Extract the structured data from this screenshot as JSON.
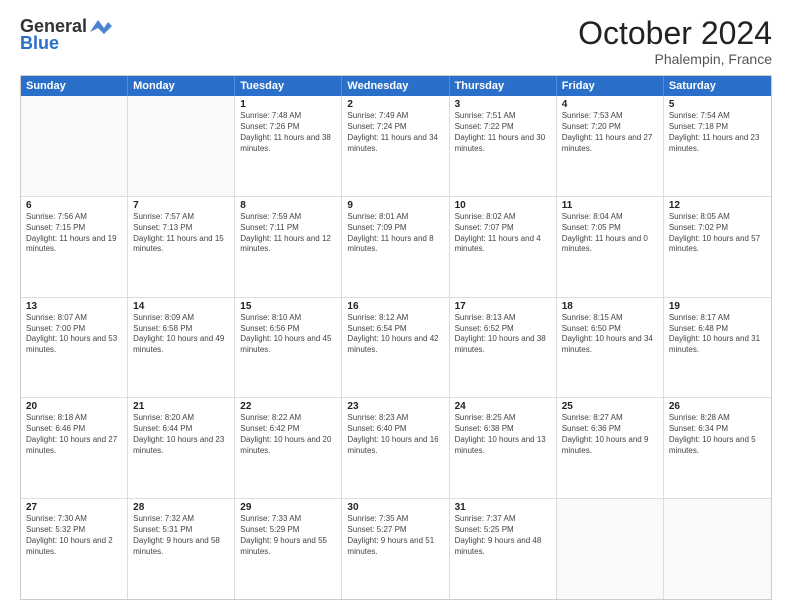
{
  "header": {
    "logo_line1": "General",
    "logo_line2": "Blue",
    "month": "October 2024",
    "location": "Phalempin, France"
  },
  "weekdays": [
    "Sunday",
    "Monday",
    "Tuesday",
    "Wednesday",
    "Thursday",
    "Friday",
    "Saturday"
  ],
  "rows": [
    [
      {
        "day": "",
        "info": ""
      },
      {
        "day": "",
        "info": ""
      },
      {
        "day": "1",
        "info": "Sunrise: 7:48 AM\nSunset: 7:26 PM\nDaylight: 11 hours and 38 minutes."
      },
      {
        "day": "2",
        "info": "Sunrise: 7:49 AM\nSunset: 7:24 PM\nDaylight: 11 hours and 34 minutes."
      },
      {
        "day": "3",
        "info": "Sunrise: 7:51 AM\nSunset: 7:22 PM\nDaylight: 11 hours and 30 minutes."
      },
      {
        "day": "4",
        "info": "Sunrise: 7:53 AM\nSunset: 7:20 PM\nDaylight: 11 hours and 27 minutes."
      },
      {
        "day": "5",
        "info": "Sunrise: 7:54 AM\nSunset: 7:18 PM\nDaylight: 11 hours and 23 minutes."
      }
    ],
    [
      {
        "day": "6",
        "info": "Sunrise: 7:56 AM\nSunset: 7:15 PM\nDaylight: 11 hours and 19 minutes."
      },
      {
        "day": "7",
        "info": "Sunrise: 7:57 AM\nSunset: 7:13 PM\nDaylight: 11 hours and 15 minutes."
      },
      {
        "day": "8",
        "info": "Sunrise: 7:59 AM\nSunset: 7:11 PM\nDaylight: 11 hours and 12 minutes."
      },
      {
        "day": "9",
        "info": "Sunrise: 8:01 AM\nSunset: 7:09 PM\nDaylight: 11 hours and 8 minutes."
      },
      {
        "day": "10",
        "info": "Sunrise: 8:02 AM\nSunset: 7:07 PM\nDaylight: 11 hours and 4 minutes."
      },
      {
        "day": "11",
        "info": "Sunrise: 8:04 AM\nSunset: 7:05 PM\nDaylight: 11 hours and 0 minutes."
      },
      {
        "day": "12",
        "info": "Sunrise: 8:05 AM\nSunset: 7:02 PM\nDaylight: 10 hours and 57 minutes."
      }
    ],
    [
      {
        "day": "13",
        "info": "Sunrise: 8:07 AM\nSunset: 7:00 PM\nDaylight: 10 hours and 53 minutes."
      },
      {
        "day": "14",
        "info": "Sunrise: 8:09 AM\nSunset: 6:58 PM\nDaylight: 10 hours and 49 minutes."
      },
      {
        "day": "15",
        "info": "Sunrise: 8:10 AM\nSunset: 6:56 PM\nDaylight: 10 hours and 45 minutes."
      },
      {
        "day": "16",
        "info": "Sunrise: 8:12 AM\nSunset: 6:54 PM\nDaylight: 10 hours and 42 minutes."
      },
      {
        "day": "17",
        "info": "Sunrise: 8:13 AM\nSunset: 6:52 PM\nDaylight: 10 hours and 38 minutes."
      },
      {
        "day": "18",
        "info": "Sunrise: 8:15 AM\nSunset: 6:50 PM\nDaylight: 10 hours and 34 minutes."
      },
      {
        "day": "19",
        "info": "Sunrise: 8:17 AM\nSunset: 6:48 PM\nDaylight: 10 hours and 31 minutes."
      }
    ],
    [
      {
        "day": "20",
        "info": "Sunrise: 8:18 AM\nSunset: 6:46 PM\nDaylight: 10 hours and 27 minutes."
      },
      {
        "day": "21",
        "info": "Sunrise: 8:20 AM\nSunset: 6:44 PM\nDaylight: 10 hours and 23 minutes."
      },
      {
        "day": "22",
        "info": "Sunrise: 8:22 AM\nSunset: 6:42 PM\nDaylight: 10 hours and 20 minutes."
      },
      {
        "day": "23",
        "info": "Sunrise: 8:23 AM\nSunset: 6:40 PM\nDaylight: 10 hours and 16 minutes."
      },
      {
        "day": "24",
        "info": "Sunrise: 8:25 AM\nSunset: 6:38 PM\nDaylight: 10 hours and 13 minutes."
      },
      {
        "day": "25",
        "info": "Sunrise: 8:27 AM\nSunset: 6:36 PM\nDaylight: 10 hours and 9 minutes."
      },
      {
        "day": "26",
        "info": "Sunrise: 8:28 AM\nSunset: 6:34 PM\nDaylight: 10 hours and 5 minutes."
      }
    ],
    [
      {
        "day": "27",
        "info": "Sunrise: 7:30 AM\nSunset: 5:32 PM\nDaylight: 10 hours and 2 minutes."
      },
      {
        "day": "28",
        "info": "Sunrise: 7:32 AM\nSunset: 5:31 PM\nDaylight: 9 hours and 58 minutes."
      },
      {
        "day": "29",
        "info": "Sunrise: 7:33 AM\nSunset: 5:29 PM\nDaylight: 9 hours and 55 minutes."
      },
      {
        "day": "30",
        "info": "Sunrise: 7:35 AM\nSunset: 5:27 PM\nDaylight: 9 hours and 51 minutes."
      },
      {
        "day": "31",
        "info": "Sunrise: 7:37 AM\nSunset: 5:25 PM\nDaylight: 9 hours and 48 minutes."
      },
      {
        "day": "",
        "info": ""
      },
      {
        "day": "",
        "info": ""
      }
    ]
  ]
}
